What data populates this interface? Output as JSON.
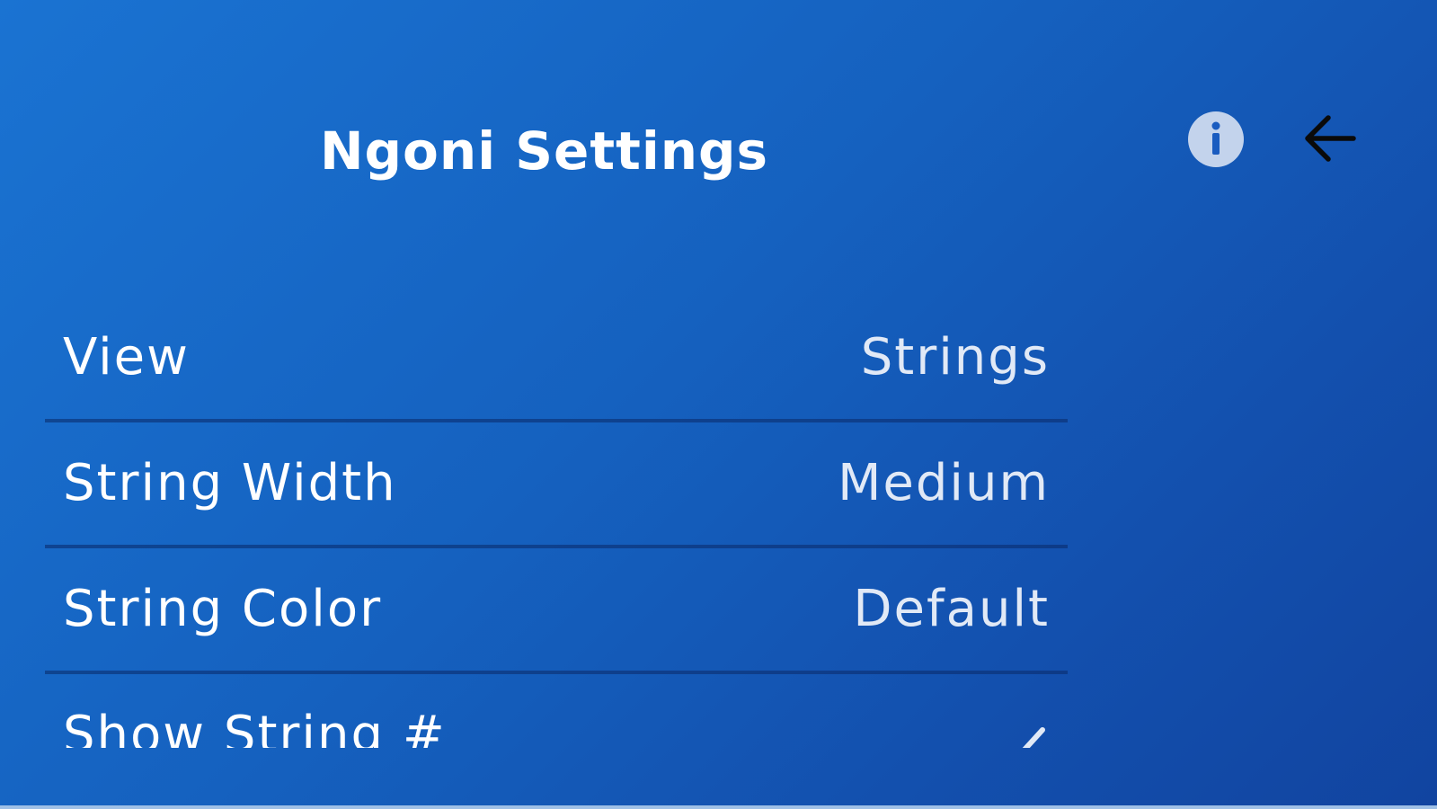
{
  "header": {
    "title": "Ngoni Settings",
    "info_icon": "info-icon",
    "back_icon": "arrow-left-icon"
  },
  "settings": {
    "rows": [
      {
        "label": "View",
        "value": "Strings"
      },
      {
        "label": "String Width",
        "value": "Medium"
      },
      {
        "label": "String Color",
        "value": "Default"
      },
      {
        "label": "Show String #",
        "value": "",
        "checked": true,
        "value_icon": "checkmark-icon"
      }
    ]
  },
  "colors": {
    "background_start": "#1a73d2",
    "background_end": "#1144a0",
    "text": "#ffffff",
    "value_text": "#e1e9f6",
    "divider": "#0a2d6e",
    "info_icon_fill": "#c3d3ec",
    "back_icon": "#0a0a0a"
  }
}
